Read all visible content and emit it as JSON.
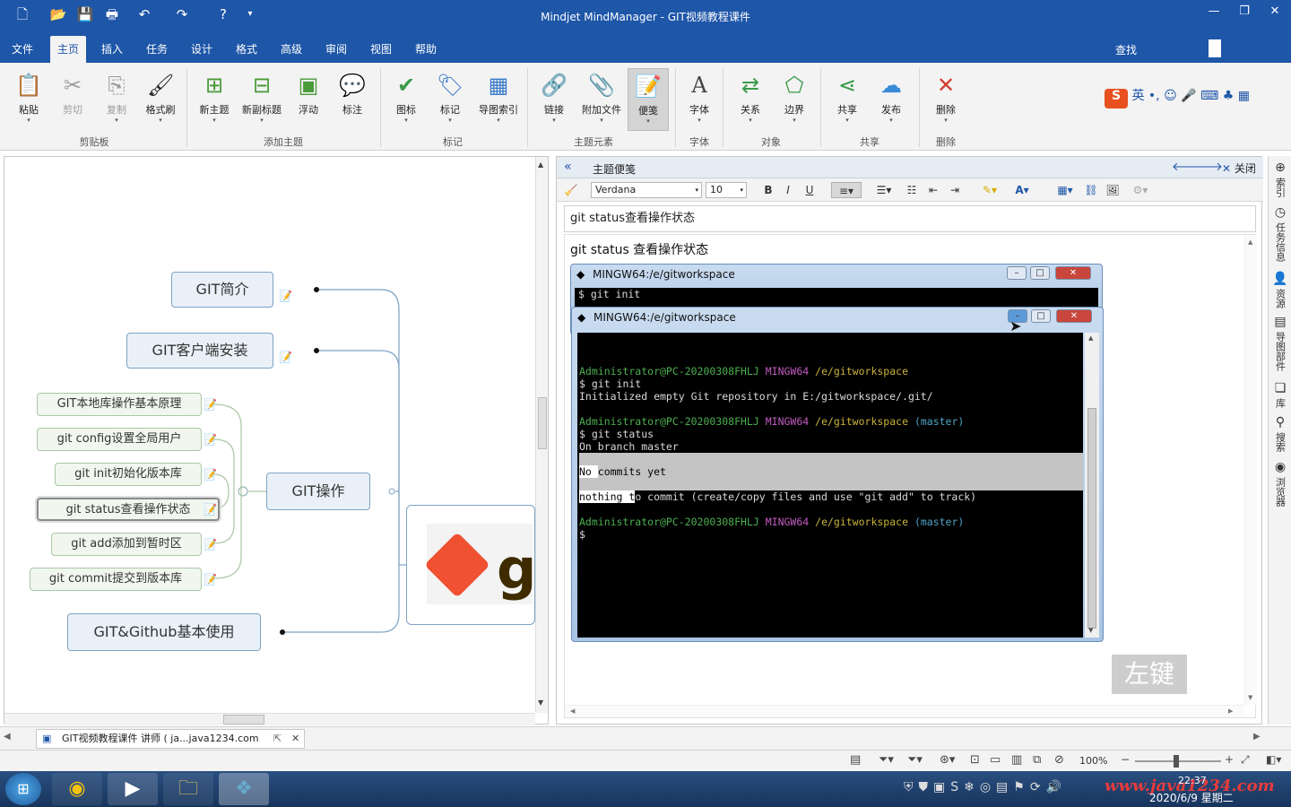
{
  "window": {
    "title": "Mindjet MindManager - GIT视频教程课件"
  },
  "menu": {
    "tabs": [
      "文件",
      "主页",
      "插入",
      "任务",
      "设计",
      "格式",
      "高级",
      "审阅",
      "视图",
      "帮助"
    ],
    "active": "主页",
    "find": "查找"
  },
  "ribbon": {
    "buttons": [
      {
        "label": "粘贴",
        "icon": "paste-icon",
        "glyph": "📋"
      },
      {
        "label": "剪切",
        "icon": "cut-icon",
        "glyph": "✂"
      },
      {
        "label": "复制",
        "icon": "copy-icon",
        "glyph": "⎘"
      },
      {
        "label": "格式刷",
        "icon": "format-painter-icon",
        "glyph": "🖌"
      },
      {
        "label": "新主题",
        "icon": "new-topic-icon",
        "glyph": "⊞"
      },
      {
        "label": "新副标题",
        "icon": "new-subtopic-icon",
        "glyph": "⊟"
      },
      {
        "label": "浮动",
        "icon": "floating-topic-icon",
        "glyph": "▣"
      },
      {
        "label": "标注",
        "icon": "callout-icon",
        "glyph": "💬"
      },
      {
        "label": "图标",
        "icon": "icon-marker-icon",
        "glyph": "✔"
      },
      {
        "label": "标记",
        "icon": "tag-icon",
        "glyph": "🏷"
      },
      {
        "label": "导图索引",
        "icon": "map-index-icon",
        "glyph": "▦"
      },
      {
        "label": "链接",
        "icon": "link-icon",
        "glyph": "🔗"
      },
      {
        "label": "附加文件",
        "icon": "attachment-icon",
        "glyph": "📎"
      },
      {
        "label": "便笺",
        "icon": "notes-icon",
        "glyph": "📝"
      },
      {
        "label": "字体",
        "icon": "font-icon",
        "glyph": "A"
      },
      {
        "label": "关系",
        "icon": "relationship-icon",
        "glyph": "⇄"
      },
      {
        "label": "边界",
        "icon": "boundary-icon",
        "glyph": "⬠"
      },
      {
        "label": "共享",
        "icon": "share-icon",
        "glyph": "⋖"
      },
      {
        "label": "发布",
        "icon": "publish-icon",
        "glyph": "☁"
      },
      {
        "label": "删除",
        "icon": "delete-icon",
        "glyph": "✕"
      }
    ],
    "groups": [
      "剪贴板",
      "添加主题",
      "标记",
      "主题元素",
      "字体",
      "对象",
      "共享",
      "删除"
    ],
    "ime_label": "英"
  },
  "map": {
    "topics": {
      "intro": "GIT简介",
      "client": "GIT客户端安装",
      "ops": "GIT操作",
      "github": "GIT&Github基本使用"
    },
    "subtopics": [
      "GIT本地库操作基本原理",
      "git config设置全局用户",
      "git init初始化版本库",
      "git status查看操作状态",
      "git add添加到暂时区",
      "git commit提交到版本库"
    ],
    "image_text": "g"
  },
  "notes": {
    "header": "主题便笺",
    "close": "关闭",
    "font": "Verdana",
    "size": "10",
    "subject": "git status查看操作状态",
    "body_line": "git status 查看操作状态"
  },
  "terminal_back": {
    "title": "MINGW64:/e/gitworkspace",
    "line1": "$ git init"
  },
  "terminal_front": {
    "title": "MINGW64:/e/gitworkspace",
    "user": "Administrator@PC-20200308FHLJ",
    "shell": "MINGW64",
    "path": "/e/gitworkspace",
    "branch": "(master)",
    "cmd1": "$ git init",
    "out1": "Initialized empty Git repository in E:/gitworkspace/.git/",
    "cmd2": "$ git status",
    "out2": "On branch master",
    "out3a": "No ",
    "out3b": "commits yet",
    "out4a": "nothing t",
    "out4b": "o commit (create/copy files and use \"git add\" to track)",
    "prompt": "$"
  },
  "overlay": {
    "key_label": "左键"
  },
  "sidebar": [
    "索引",
    "任务信息",
    "资源",
    "导图部件",
    "库",
    "搜索",
    "浏览器"
  ],
  "doc_tab": {
    "label": "GIT视频教程课件 讲师 ( ja...java1234.com"
  },
  "status": {
    "zoom": "100%"
  },
  "taskbar": {
    "date": "2020/6/9 星期二",
    "time": "22:37",
    "watermark": "www.java1234.com"
  }
}
